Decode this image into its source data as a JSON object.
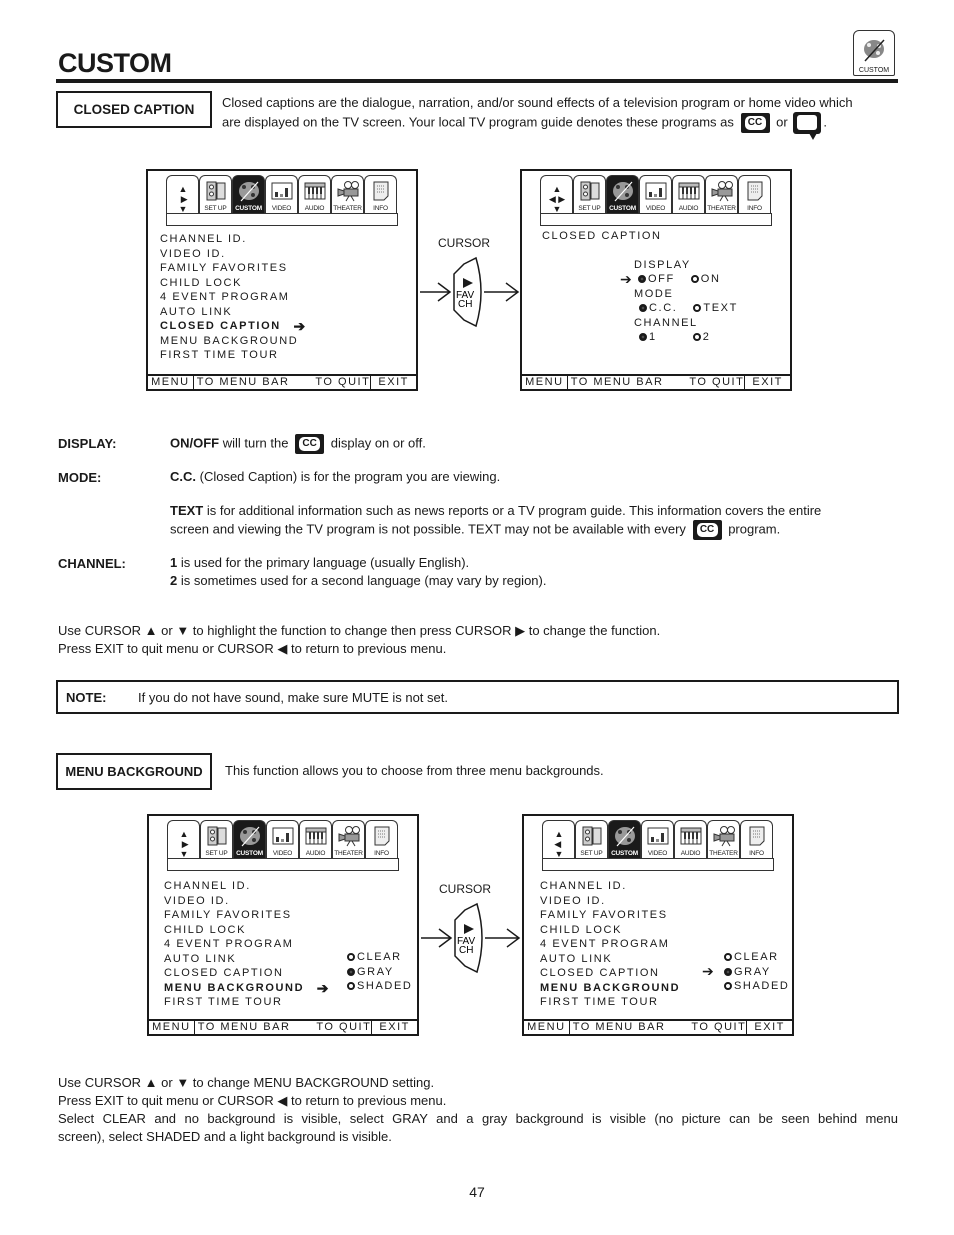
{
  "header": {
    "title": "CUSTOM",
    "badge_label": "CUSTOM"
  },
  "closed_caption_section": {
    "heading": "CLOSED CAPTION",
    "intro_line1": "Closed captions are the dialogue, narration, and/or sound effects of a television program or home video which",
    "intro_line2": "are displayed on the TV screen.  Your local TV program guide denotes these programs as",
    "intro_or": "or",
    "intro_end": ".",
    "cc_icon_text": "CC"
  },
  "menu_tabs": [
    {
      "label": "",
      "icon": "cursor-arrows-icon"
    },
    {
      "label": "SET UP",
      "icon": "setup-icon"
    },
    {
      "label": "CUSTOM",
      "icon": "palette-icon",
      "active": true
    },
    {
      "label": "VIDEO",
      "icon": "video-bars-icon"
    },
    {
      "label": "AUDIO",
      "icon": "piano-keys-icon"
    },
    {
      "label": "THEATER",
      "icon": "movie-camera-icon"
    },
    {
      "label": "INFO",
      "icon": "document-icon"
    }
  ],
  "bottom_bar": {
    "menu": "MENU",
    "to_menu_bar": "TO MENU BAR",
    "to_quit": "TO QUIT",
    "exit": "EXIT"
  },
  "custom_menu_items": [
    "CHANNEL ID.",
    "VIDEO ID.",
    "FAMILY FAVORITES",
    "CHILD LOCK",
    "4 EVENT PROGRAM",
    "AUTO LINK",
    "CLOSED CAPTION",
    "MENU BACKGROUND",
    "FIRST TIME TOUR"
  ],
  "cursor_button": {
    "label": "CURSOR",
    "fav": "FAV",
    "ch": "CH"
  },
  "cc_screen": {
    "title": "CLOSED CAPTION",
    "display_label": "DISPLAY",
    "display_options": [
      "OFF",
      "ON"
    ],
    "display_selected": "OFF",
    "mode_label": "MODE",
    "mode_options": [
      "C.C.",
      "TEXT"
    ],
    "mode_selected": "C.C.",
    "channel_label": "CHANNEL",
    "channel_options": [
      "1",
      "2"
    ],
    "channel_selected": "1"
  },
  "descriptions": {
    "display_label": "DISPLAY:",
    "display_bold": "ON/OFF",
    "display_text_a": " will turn the",
    "display_text_b": "display on or off.",
    "mode_label": "MODE:",
    "mode_bold": "C.C.",
    "mode_text": " (Closed Caption) is for the program you are viewing.",
    "text_bold": "TEXT",
    "text_line1": " is for additional information such as news reports or a TV program guide.  This information covers the entire",
    "text_line2a": "screen and viewing the TV program is not possible.  TEXT may not be available with every",
    "text_line2b": "program.",
    "channel_label": "CHANNEL:",
    "ch1_bold": "1",
    "ch1_text": " is used for the primary language (usually English).",
    "ch2_bold": "2",
    "ch2_text": " is sometimes used for a second language (may vary by region)."
  },
  "instructions_cc": {
    "line1": "Use CURSOR ▲ or ▼ to highlight the function to change then press CURSOR ▶ to change the function.",
    "line2": "Press EXIT to quit menu or CURSOR ◀ to return to previous menu."
  },
  "note": {
    "label": "NOTE:",
    "text": "If you do not have sound, make sure MUTE is not set."
  },
  "menu_background_section": {
    "heading": "MENU BACKGROUND",
    "intro": "This function allows you to choose from three menu backgrounds.",
    "options": [
      "CLEAR",
      "GRAY",
      "SHADED"
    ],
    "selected": "GRAY"
  },
  "instructions_mb": {
    "line1": "Use CURSOR ▲ or ▼ to change MENU BACKGROUND setting.",
    "line2": "Press EXIT to quit menu or CURSOR ◀ to return to previous menu.",
    "line3": "Select CLEAR and no background is visible, select GRAY and a gray background is visible (no picture can be seen behind menu",
    "line4": "screen), select SHADED and a light background is visible."
  },
  "page_number": "47"
}
